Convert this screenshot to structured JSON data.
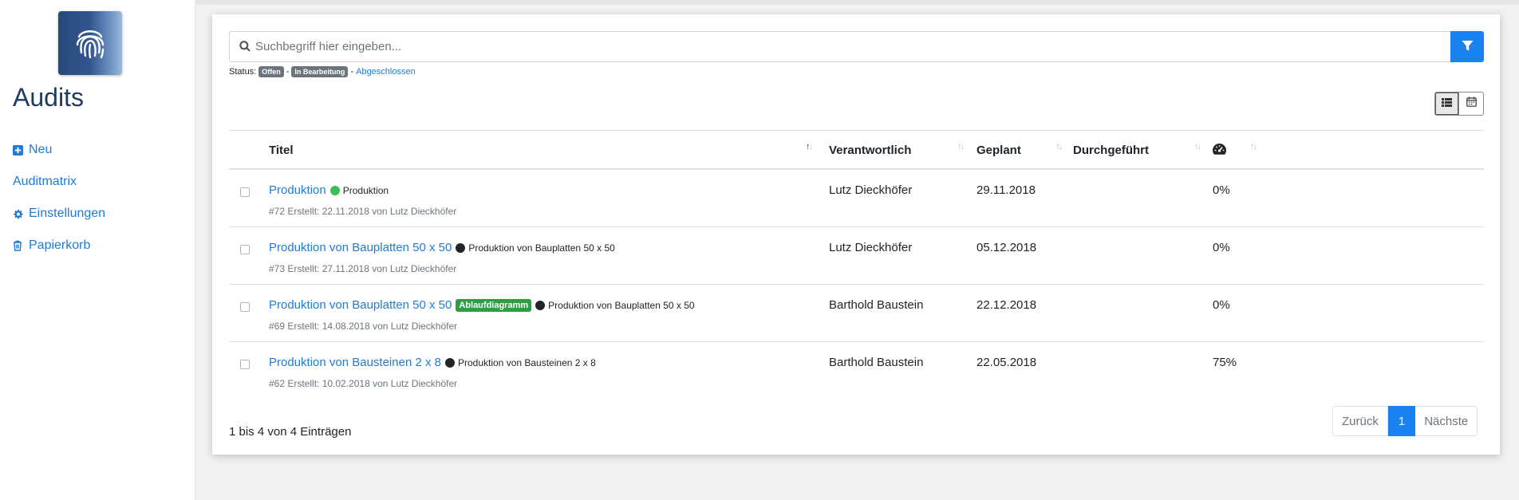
{
  "sidebar": {
    "logo_icon": "fingerprint-icon",
    "app_title": "Audits",
    "items": [
      {
        "label": "Neu",
        "icon": "plus-square-icon"
      },
      {
        "label": "Auditmatrix",
        "icon": ""
      },
      {
        "label": "Einstellungen",
        "icon": "gear-icon"
      },
      {
        "label": "Papierkorb",
        "icon": "trash-icon"
      }
    ]
  },
  "search": {
    "placeholder": "Suchbegriff hier eingeben...",
    "value": "",
    "filter_icon": "filter-icon"
  },
  "status": {
    "label": "Status:",
    "badge_open": "Offen",
    "sep1": "-",
    "badge_in_progress": "In Bearbeitung",
    "sep2": "-",
    "link_closed": "Abgeschlossen"
  },
  "view_toggle": {
    "list_icon": "list-icon",
    "calendar_icon": "calendar-icon",
    "active": "list"
  },
  "table": {
    "columns": {
      "title": "Titel",
      "responsible": "Verantwortlich",
      "planned": "Geplant",
      "done": "Durchgeführt",
      "progress_icon": "gauge-icon"
    },
    "rows": [
      {
        "title": "Produktion",
        "tag": "",
        "dot": "green",
        "sub": "Produktion",
        "meta": "#72 Erstellt: 22.11.2018 von Lutz Dieckhöfer",
        "responsible": "Lutz Dieckhöfer",
        "planned": "29.11.2018",
        "done": "",
        "progress": "0%"
      },
      {
        "title": "Produktion von Bauplatten 50 x 50",
        "tag": "",
        "dot": "dark",
        "sub": "Produktion von Bauplatten 50 x 50",
        "meta": "#73 Erstellt: 27.11.2018 von Lutz Dieckhöfer",
        "responsible": "Lutz Dieckhöfer",
        "planned": "05.12.2018",
        "done": "",
        "progress": "0%"
      },
      {
        "title": "Produktion von Bauplatten 50 x 50",
        "tag": "Ablaufdiagramm",
        "dot": "dark",
        "sub": "Produktion von Bauplatten 50 x 50",
        "meta": "#69 Erstellt: 14.08.2018 von Lutz Dieckhöfer",
        "responsible": "Barthold Baustein",
        "planned": "22.12.2018",
        "done": "",
        "progress": "0%"
      },
      {
        "title": "Produktion von Bausteinen 2 x 8",
        "tag": "",
        "dot": "dark",
        "sub": "Produktion von Bausteinen 2 x 8",
        "meta": "#62 Erstellt: 10.02.2018 von Lutz Dieckhöfer",
        "responsible": "Barthold Baustein",
        "planned": "22.05.2018",
        "done": "",
        "progress": "75%"
      }
    ]
  },
  "footer": {
    "info": "1 bis 4 von 4 Einträgen",
    "prev": "Zurück",
    "current_page": "1",
    "next": "Nächste"
  },
  "colors": {
    "accent": "#1a82f0",
    "link": "#1f7bd6",
    "title": "#1f3b63",
    "tag_green": "#2e9e44"
  }
}
